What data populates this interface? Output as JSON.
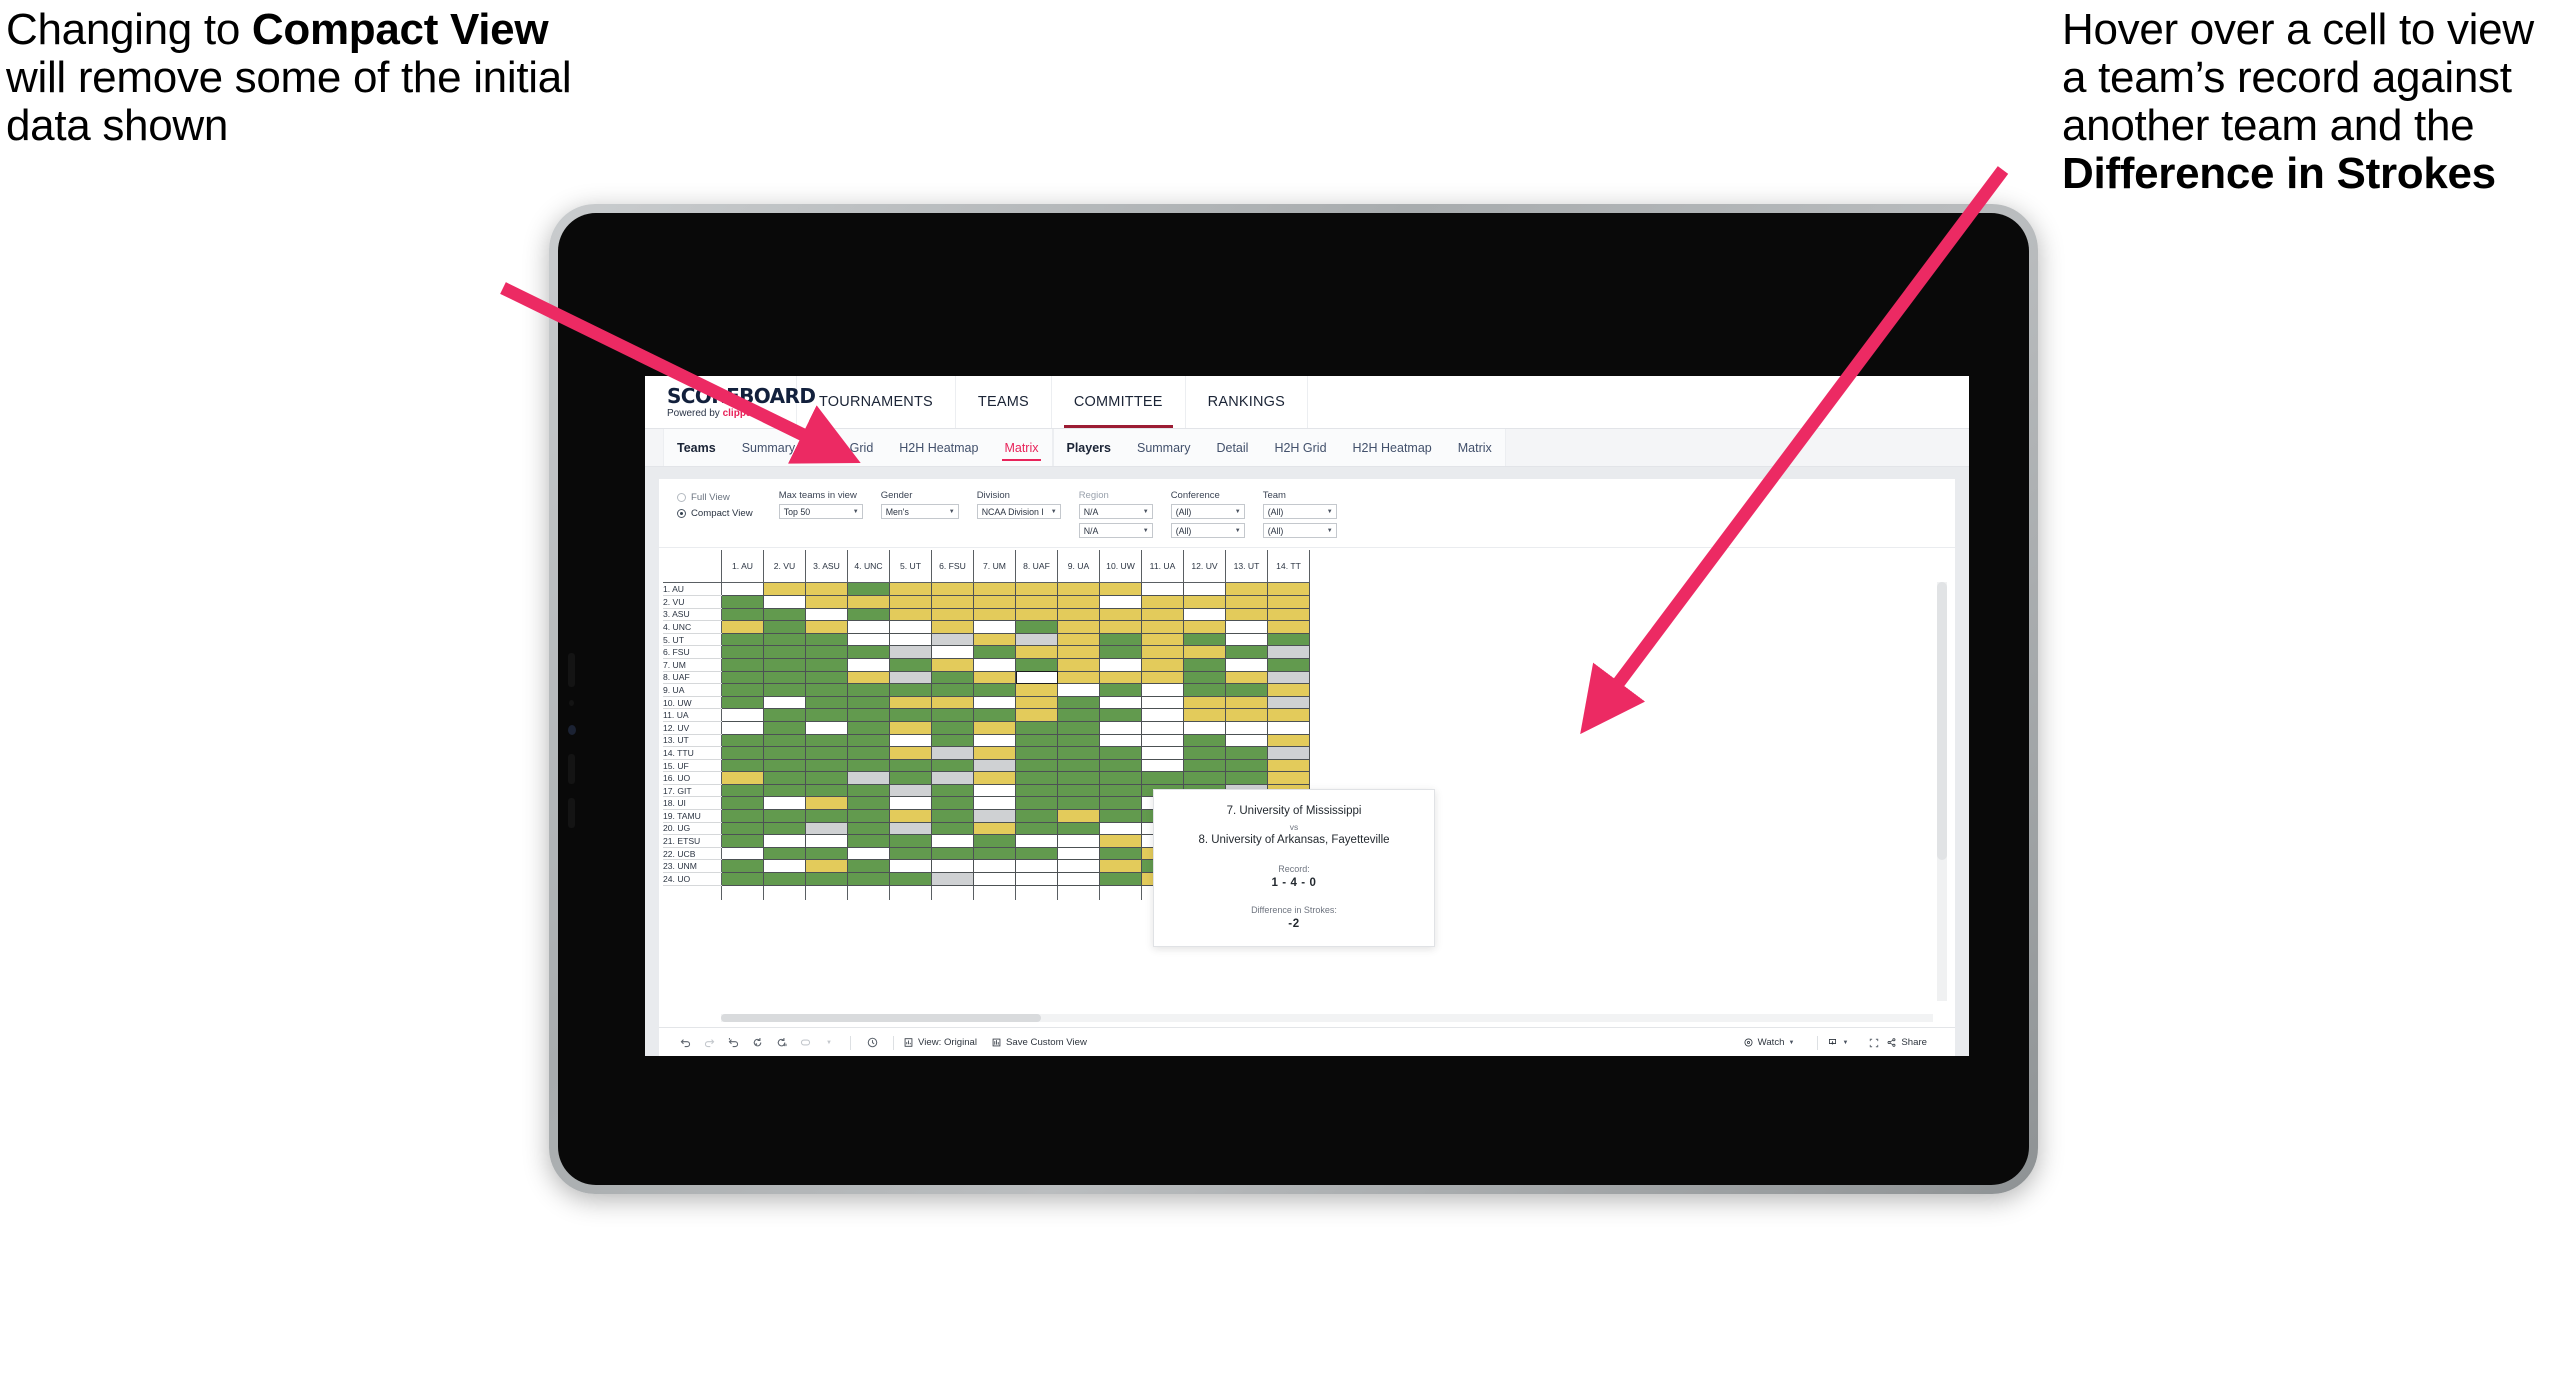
{
  "annotations": {
    "left": {
      "name": "compact-view-note",
      "parts": [
        {
          "t": "Changing to ",
          "b": false
        },
        {
          "t": "Compact View",
          "b": true
        },
        {
          "t": " will remove some of the initial data shown",
          "b": false
        }
      ]
    },
    "right": {
      "name": "hover-tooltip-note",
      "parts": [
        {
          "t": "Hover over a cell to view a team’s record against another team and the ",
          "b": false
        },
        {
          "t": "Difference in Strokes",
          "b": true
        }
      ]
    },
    "arrow_color": "#ec2a63"
  },
  "app": {
    "brand": {
      "title": "SCOREBOARD",
      "powered_prefix": "Powered by ",
      "powered_name": "clippd"
    },
    "topnav": [
      {
        "label": "TOURNAMENTS",
        "active": false
      },
      {
        "label": "TEAMS",
        "active": false
      },
      {
        "label": "COMMITTEE",
        "active": true
      },
      {
        "label": "RANKINGS",
        "active": false
      }
    ],
    "subnav_teams": [
      {
        "label": "Teams",
        "active": false,
        "group": true
      },
      {
        "label": "Summary",
        "active": false,
        "group": false
      },
      {
        "label": "H2H Grid",
        "active": false,
        "group": false
      },
      {
        "label": "H2H Heatmap",
        "active": false,
        "group": false
      },
      {
        "label": "Matrix",
        "active": true,
        "group": false
      }
    ],
    "subnav_players": [
      {
        "label": "Players",
        "active": false,
        "group": true
      },
      {
        "label": "Summary",
        "active": false,
        "group": false
      },
      {
        "label": "Detail",
        "active": false,
        "group": false
      },
      {
        "label": "H2H Grid",
        "active": false,
        "group": false
      },
      {
        "label": "H2H Heatmap",
        "active": false,
        "group": false
      },
      {
        "label": "Matrix",
        "active": false,
        "group": false
      }
    ]
  },
  "filters": {
    "view_mode": {
      "options": [
        {
          "label": "Full View",
          "selected": false
        },
        {
          "label": "Compact View",
          "selected": true
        }
      ]
    },
    "max_teams": {
      "label": "Max teams in view",
      "value": "Top 50"
    },
    "gender": {
      "label": "Gender",
      "value": "Men's"
    },
    "division": {
      "label": "Division",
      "value": "NCAA Division I"
    },
    "region": {
      "label": "Region",
      "value1": "N/A",
      "value2": "N/A"
    },
    "conference": {
      "label": "Conference",
      "value1": "(All)",
      "value2": "(All)"
    },
    "team": {
      "label": "Team",
      "value1": "(All)",
      "value2": "(All)"
    }
  },
  "matrix": {
    "columns": [
      "1. AU",
      "2. VU",
      "3. ASU",
      "4. UNC",
      "5. UT",
      "6. FSU",
      "7. UM",
      "8. UAF",
      "9. UA",
      "10. UW",
      "11. UA",
      "12. UV",
      "13. UT",
      "14. TT"
    ],
    "rows": [
      "1. AU",
      "2. VU",
      "3. ASU",
      "4. UNC",
      "5. UT",
      "6. FSU",
      "7. UM",
      "8. UAF",
      "9. UA",
      "10. UW",
      "11. UA",
      "12. UV",
      "13. UT",
      "14. TTU",
      "15. UF",
      "16. UO",
      "17. GIT",
      "18. UI",
      "19. TAMU",
      "20. UG",
      "21. ETSU",
      "22. UCB",
      "23. UNM",
      "24. UO"
    ],
    "legend": {
      "win": "#629a4e",
      "loss": "#e3cb5b",
      "none": "#ffffff",
      "tie": "#cfd1d3"
    },
    "cells": [
      [
        "w",
        "y",
        "y",
        "g",
        "y",
        "y",
        "y",
        "y",
        "y",
        "y",
        "w",
        "w",
        "y",
        "y"
      ],
      [
        "g",
        "w",
        "y",
        "y",
        "y",
        "y",
        "y",
        "y",
        "y",
        "w",
        "y",
        "y",
        "y",
        "y"
      ],
      [
        "g",
        "g",
        "w",
        "g",
        "y",
        "y",
        "y",
        "y",
        "y",
        "y",
        "y",
        "w",
        "y",
        "y"
      ],
      [
        "y",
        "g",
        "y",
        "w",
        "w",
        "y",
        "w",
        "g",
        "y",
        "y",
        "y",
        "y",
        "w",
        "y"
      ],
      [
        "g",
        "g",
        "g",
        "w",
        "w",
        "a",
        "y",
        "a",
        "y",
        "g",
        "y",
        "g",
        "w",
        "g"
      ],
      [
        "g",
        "g",
        "g",
        "g",
        "a",
        "w",
        "g",
        "y",
        "y",
        "g",
        "y",
        "y",
        "g",
        "a"
      ],
      [
        "g",
        "g",
        "g",
        "w",
        "g",
        "y",
        "w",
        "g",
        "y",
        "w",
        "y",
        "g",
        "w",
        "g"
      ],
      [
        "g",
        "g",
        "g",
        "y",
        "a",
        "g",
        "y",
        "w",
        "y",
        "y",
        "y",
        "g",
        "y",
        "a"
      ],
      [
        "g",
        "g",
        "g",
        "g",
        "g",
        "g",
        "g",
        "y",
        "w",
        "g",
        "w",
        "g",
        "g",
        "y"
      ],
      [
        "g",
        "w",
        "g",
        "g",
        "y",
        "y",
        "w",
        "y",
        "g",
        "w",
        "w",
        "y",
        "y",
        "a"
      ],
      [
        "w",
        "g",
        "g",
        "g",
        "g",
        "g",
        "g",
        "y",
        "g",
        "g",
        "w",
        "y",
        "y",
        "y"
      ],
      [
        "w",
        "g",
        "w",
        "g",
        "y",
        "g",
        "y",
        "g",
        "g",
        "w",
        "w",
        "w",
        "w",
        "w"
      ],
      [
        "g",
        "g",
        "g",
        "g",
        "w",
        "g",
        "w",
        "g",
        "g",
        "w",
        "w",
        "g",
        "w",
        "y"
      ],
      [
        "g",
        "g",
        "g",
        "g",
        "y",
        "a",
        "y",
        "g",
        "g",
        "g",
        "w",
        "g",
        "g",
        "a"
      ],
      [
        "g",
        "g",
        "g",
        "g",
        "g",
        "g",
        "a",
        "g",
        "g",
        "g",
        "w",
        "g",
        "g",
        "y"
      ],
      [
        "y",
        "g",
        "g",
        "a",
        "g",
        "a",
        "y",
        "g",
        "g",
        "g",
        "g",
        "g",
        "g",
        "y"
      ],
      [
        "g",
        "g",
        "g",
        "g",
        "a",
        "g",
        "w",
        "g",
        "g",
        "g",
        "g",
        "g",
        "a",
        "y"
      ],
      [
        "g",
        "w",
        "y",
        "g",
        "w",
        "g",
        "w",
        "g",
        "g",
        "g",
        "w",
        "g",
        "g",
        "w"
      ],
      [
        "g",
        "g",
        "g",
        "g",
        "y",
        "g",
        "a",
        "g",
        "y",
        "g",
        "g",
        "g",
        "g",
        "a"
      ],
      [
        "g",
        "g",
        "a",
        "g",
        "a",
        "g",
        "y",
        "g",
        "g",
        "w",
        "w",
        "g",
        "g",
        "a"
      ],
      [
        "g",
        "w",
        "w",
        "g",
        "g",
        "w",
        "g",
        "w",
        "w",
        "y",
        "w",
        "g",
        "g",
        "g"
      ],
      [
        "w",
        "g",
        "g",
        "w",
        "g",
        "g",
        "g",
        "g",
        "w",
        "g",
        "y",
        "w",
        "g",
        "y"
      ],
      [
        "g",
        "w",
        "y",
        "g",
        "w",
        "w",
        "w",
        "w",
        "w",
        "y",
        "g",
        "w",
        "g",
        "g"
      ],
      [
        "g",
        "g",
        "g",
        "g",
        "g",
        "a",
        "w",
        "w",
        "w",
        "g",
        "y",
        "w",
        "y",
        "g"
      ]
    ],
    "selected_cell": {
      "row": 7,
      "col": 7
    }
  },
  "tooltip": {
    "team_a": "7. University of Mississippi",
    "vs": "vs",
    "team_b": "8. University of Arkansas, Fayetteville",
    "record_label": "Record:",
    "record_value": "1 - 4 - 0",
    "strokes_label": "Difference in Strokes:",
    "strokes_value": "-2"
  },
  "toolbar": {
    "view_original": "View: Original",
    "save_custom_view": "Save Custom View",
    "watch": "Watch",
    "share": "Share"
  }
}
